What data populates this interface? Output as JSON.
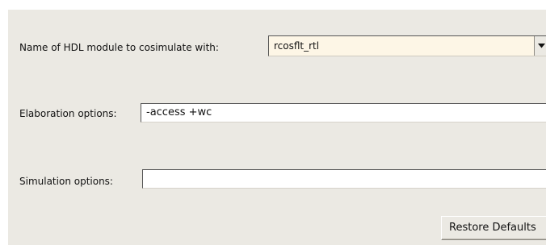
{
  "form": {
    "module": {
      "label": "Name of HDL module to cosimulate with:",
      "value": "rcosflt_rtl",
      "dropdown_icon": "triangle-down-icon"
    },
    "elaboration": {
      "label": "Elaboration options:",
      "value": "-access +wc"
    },
    "simulation": {
      "label": "Simulation options:",
      "value": ""
    },
    "restore_defaults_label": "Restore Defaults"
  }
}
